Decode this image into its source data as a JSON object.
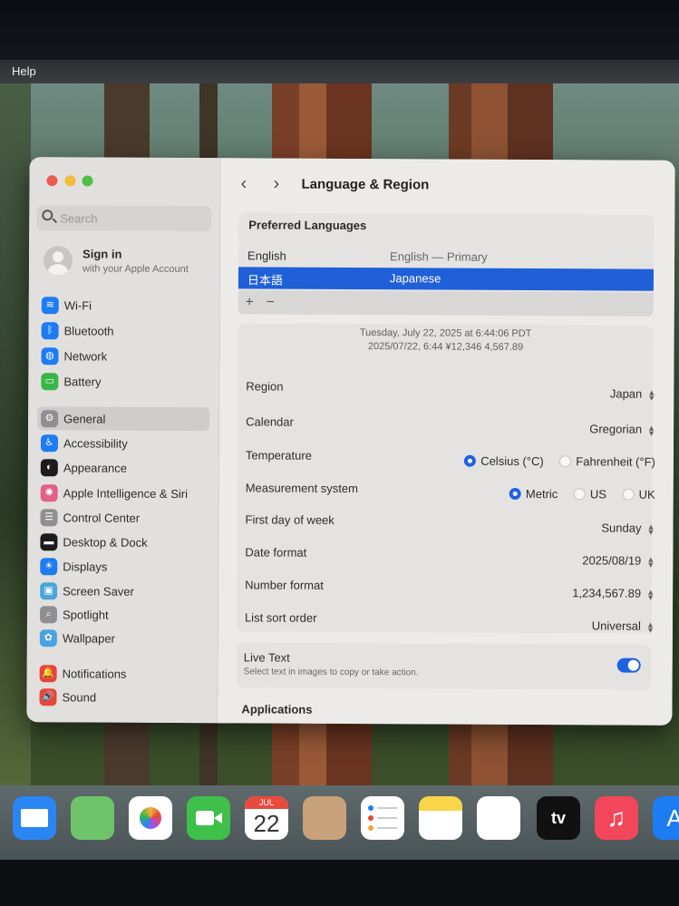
{
  "menubar": {
    "item": "Help"
  },
  "window": {
    "title": "Language & Region",
    "search_placeholder": "Search",
    "account": {
      "title": "Sign in",
      "subtitle": "with your Apple Account"
    },
    "sidebar": [
      {
        "label": "Wi-Fi",
        "icon": "wifi-icon",
        "color": "#1e7cf2",
        "glyph": "≋"
      },
      {
        "label": "Bluetooth",
        "icon": "bluetooth-icon",
        "color": "#1e7cf2",
        "glyph": "ᛒ"
      },
      {
        "label": "Network",
        "icon": "network-icon",
        "color": "#1e7cf2",
        "glyph": "◍"
      },
      {
        "label": "Battery",
        "icon": "battery-icon",
        "color": "#39b54a",
        "glyph": "▭"
      },
      {
        "label": "General",
        "icon": "gear-icon",
        "color": "#8e8e93",
        "glyph": "⚙",
        "selected": true
      },
      {
        "label": "Accessibility",
        "icon": "accessibility-icon",
        "color": "#1e7cf2",
        "glyph": "♿"
      },
      {
        "label": "Appearance",
        "icon": "appearance-icon",
        "color": "#1c1c1e",
        "glyph": "◐"
      },
      {
        "label": "Apple Intelligence & Siri",
        "icon": "siri-icon",
        "color": "#e0608a",
        "glyph": "✺"
      },
      {
        "label": "Control Center",
        "icon": "control-center-icon",
        "color": "#8e8e93",
        "glyph": "☰"
      },
      {
        "label": "Desktop & Dock",
        "icon": "dock-icon",
        "color": "#1c1c1e",
        "glyph": "▬"
      },
      {
        "label": "Displays",
        "icon": "displays-icon",
        "color": "#1e7cf2",
        "glyph": "☀"
      },
      {
        "label": "Screen Saver",
        "icon": "screen-saver-icon",
        "color": "#49a7d8",
        "glyph": "▣"
      },
      {
        "label": "Spotlight",
        "icon": "spotlight-icon",
        "color": "#8e8e93",
        "glyph": "⌕"
      },
      {
        "label": "Wallpaper",
        "icon": "wallpaper-icon",
        "color": "#4aa3e0",
        "glyph": "✿"
      },
      {
        "label": "Notifications",
        "icon": "notifications-icon",
        "color": "#e8453c",
        "glyph": "🔔"
      },
      {
        "label": "Sound",
        "icon": "sound-icon",
        "color": "#e8453c",
        "glyph": "🔊"
      }
    ],
    "preferred_languages": {
      "heading": "Preferred Languages",
      "rows": [
        {
          "name": "English",
          "detail": "English — Primary"
        },
        {
          "name": "日本語",
          "detail": "Japanese",
          "selected": true
        }
      ],
      "add": "+",
      "remove": "−"
    },
    "preview": {
      "line1": "Tuesday, July 22, 2025 at 6:44:06 PDT",
      "line2": "2025/07/22, 6:44     ¥12,346     4,567.89"
    },
    "settings": [
      {
        "label": "Region",
        "value": "Japan"
      },
      {
        "label": "Calendar",
        "value": "Gregorian"
      },
      {
        "label": "First day of week",
        "value": "Sunday"
      },
      {
        "label": "Date format",
        "value": "2025/08/19"
      },
      {
        "label": "Number format",
        "value": "1,234,567.89"
      },
      {
        "label": "List sort order",
        "value": "Universal"
      }
    ],
    "temperature": {
      "label": "Temperature",
      "options": [
        "Celsius (°C)",
        "Fahrenheit (°F)"
      ],
      "selected": 0
    },
    "measurement": {
      "label": "Measurement system",
      "options": [
        "Metric",
        "US",
        "UK"
      ],
      "selected": 0
    },
    "live_text": {
      "title": "Live Text",
      "description": "Select text in images to copy or take action.",
      "enabled": true
    },
    "applications_heading": "Applications"
  },
  "dock": {
    "calendar_month": "JUL",
    "calendar_day": "22",
    "tv_label": "tv",
    "items": [
      {
        "icon": "mail-icon",
        "color": "#2a86f3"
      },
      {
        "icon": "maps-icon",
        "color": "#6fc36b"
      },
      {
        "icon": "photos-icon",
        "color": "#ffffff"
      },
      {
        "icon": "facetime-icon",
        "color": "#3ec04a"
      },
      {
        "icon": "calendar-icon",
        "color": "#ffffff"
      },
      {
        "icon": "contacts-icon",
        "color": "#c7a27a"
      },
      {
        "icon": "reminders-icon",
        "color": "#ffffff"
      },
      {
        "icon": "notes-icon",
        "color": "#f9d54a"
      },
      {
        "icon": "freeform-icon",
        "color": "#ffffff"
      },
      {
        "icon": "apple-tv-icon",
        "color": "#111111"
      },
      {
        "icon": "music-icon",
        "color": "#f2465a"
      },
      {
        "icon": "app-store-icon",
        "color": "#1e7cf2"
      }
    ]
  }
}
